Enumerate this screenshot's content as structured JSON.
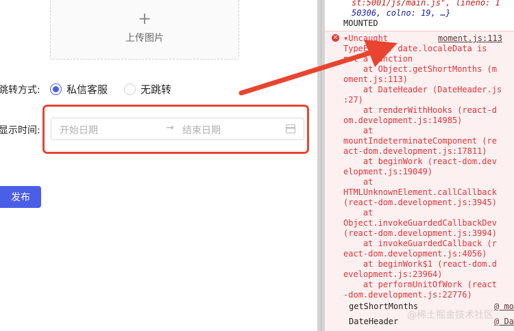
{
  "form": {
    "upload": {
      "plus": "+",
      "label": "上传图片"
    },
    "jump_label": "跳转方式:",
    "radios": [
      {
        "label": "私信客服",
        "checked": true
      },
      {
        "label": "无跳转",
        "checked": false
      }
    ],
    "time_label": "显示时间:",
    "range": {
      "start_placeholder": "开始日期",
      "separator": "→",
      "end_placeholder": "结束日期",
      "icon": "calendar-icon"
    },
    "publish_label": "发布"
  },
  "console": {
    "top_lines": [
      "st:5001/js/main.js\", lineno: 1",
      "50306, colno: 19, …}"
    ],
    "mounted": "MOUNTED",
    "error": {
      "header": "▾Uncaught",
      "header_link": "moment.js:113",
      "lines": [
        "TypeError: date.localeData is",
        "not a function",
        "    at Object.getShortMonths (m",
        "oment.js:113)",
        "    at DateHeader (DateHeader.js",
        ":27)",
        "    at renderWithHooks (react-d",
        "om.development.js:14985)",
        "    at",
        "mountIndeterminateComponent (re",
        "act-dom.development.js:17811)",
        "    at beginWork (react-dom.dev",
        "elopment.js:19049)",
        "    at",
        "HTMLUnknownElement.callCallback",
        "(react-dom.development.js:3945)",
        "    at",
        "Object.invokeGuardedCallbackDev",
        "(react-dom.development.js:3994)",
        "    at invokeGuardedCallback (r",
        "eact-dom.development.js:4056)",
        "    at beginWork$1 (react-dom.d",
        "evelopment.js:23964)",
        "    at performUnitOfWork (react",
        "-dom.development.js:22776)"
      ],
      "trace": [
        {
          "name": "getShortMonths",
          "at": "@ mo"
        },
        {
          "name": "DateHeader",
          "at": "@ Da"
        }
      ]
    }
  },
  "watermark": "@稀土掘金技术社区",
  "colors": {
    "accent": "#4a5ee6",
    "highlight": "#e8442f",
    "error_text": "#e0343b",
    "error_bg": "#fdf0f0"
  }
}
